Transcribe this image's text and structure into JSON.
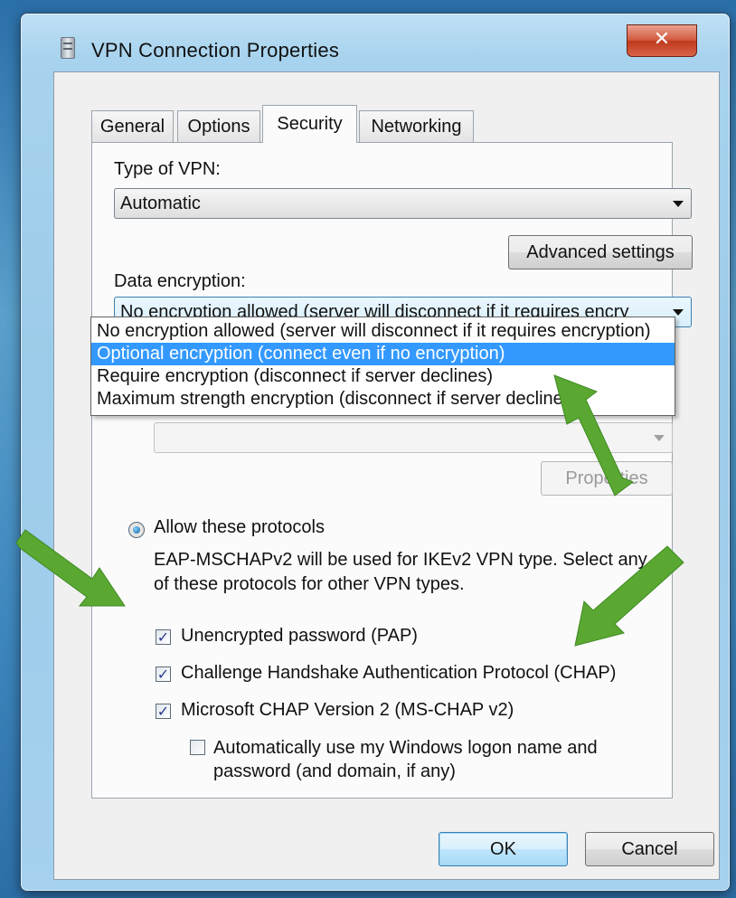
{
  "window": {
    "title": "VPN Connection Properties",
    "close_glyph": "✕"
  },
  "tabs": [
    {
      "label": "General"
    },
    {
      "label": "Options"
    },
    {
      "label": "Security",
      "active": true
    },
    {
      "label": "Networking"
    }
  ],
  "security": {
    "type_of_vpn_label": "Type of VPN:",
    "type_of_vpn_value": "Automatic",
    "advanced_settings_label": "Advanced settings",
    "data_encryption_label": "Data encryption:",
    "data_encryption_value": "No encryption allowed (server will disconnect if it requires encry",
    "encryption_options": [
      "No encryption allowed (server will disconnect if it requires encryption)",
      "Optional encryption (connect even if no encryption)",
      "Require encryption (disconnect if server declines)",
      "Maximum strength encryption (disconnect if server declines)"
    ],
    "highlighted_option_index": 1,
    "properties_label": "Properties",
    "allow_protocols_label": "Allow these protocols",
    "protocols_note": "EAP-MSCHAPv2 will be used for IKEv2 VPN type. Select any of these protocols for other VPN types.",
    "protocols": [
      {
        "label": "Unencrypted password (PAP)",
        "checked": true
      },
      {
        "label": "Challenge Handshake Authentication Protocol (CHAP)",
        "checked": true
      },
      {
        "label": "Microsoft CHAP Version 2 (MS-CHAP v2)",
        "checked": true
      }
    ],
    "auto_logon_label": "Automatically use my Windows logon name and password (and domain, if any)",
    "auto_logon_checked": false
  },
  "buttons": {
    "ok": "OK",
    "cancel": "Cancel"
  },
  "colors": {
    "annotation_arrow": "#5aa832",
    "selection_highlight": "#3399ff",
    "close_button": "#c8432a"
  }
}
